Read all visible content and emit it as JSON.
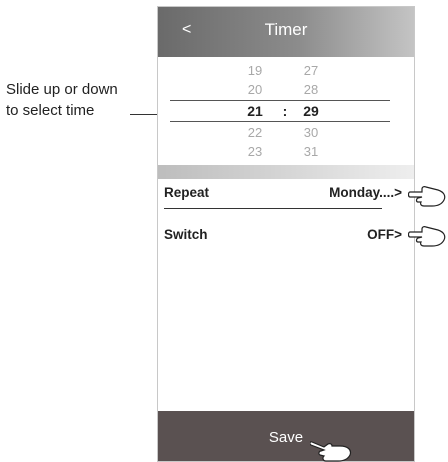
{
  "annotation": {
    "line1": "Slide up or down",
    "line2": "to select time"
  },
  "header": {
    "back_label": "<",
    "title": "Timer"
  },
  "picker": {
    "rows": [
      {
        "hour": "19",
        "minute": "27"
      },
      {
        "hour": "20",
        "minute": "28"
      },
      {
        "hour": "21",
        "minute": "29"
      },
      {
        "hour": "22",
        "minute": "30"
      },
      {
        "hour": "23",
        "minute": "31"
      }
    ],
    "separator": ":"
  },
  "settings": {
    "repeat": {
      "label": "Repeat",
      "value": "Monday....>"
    },
    "switch": {
      "label": "Switch",
      "value": "OFF>"
    }
  },
  "footer": {
    "save_label": "Save"
  }
}
